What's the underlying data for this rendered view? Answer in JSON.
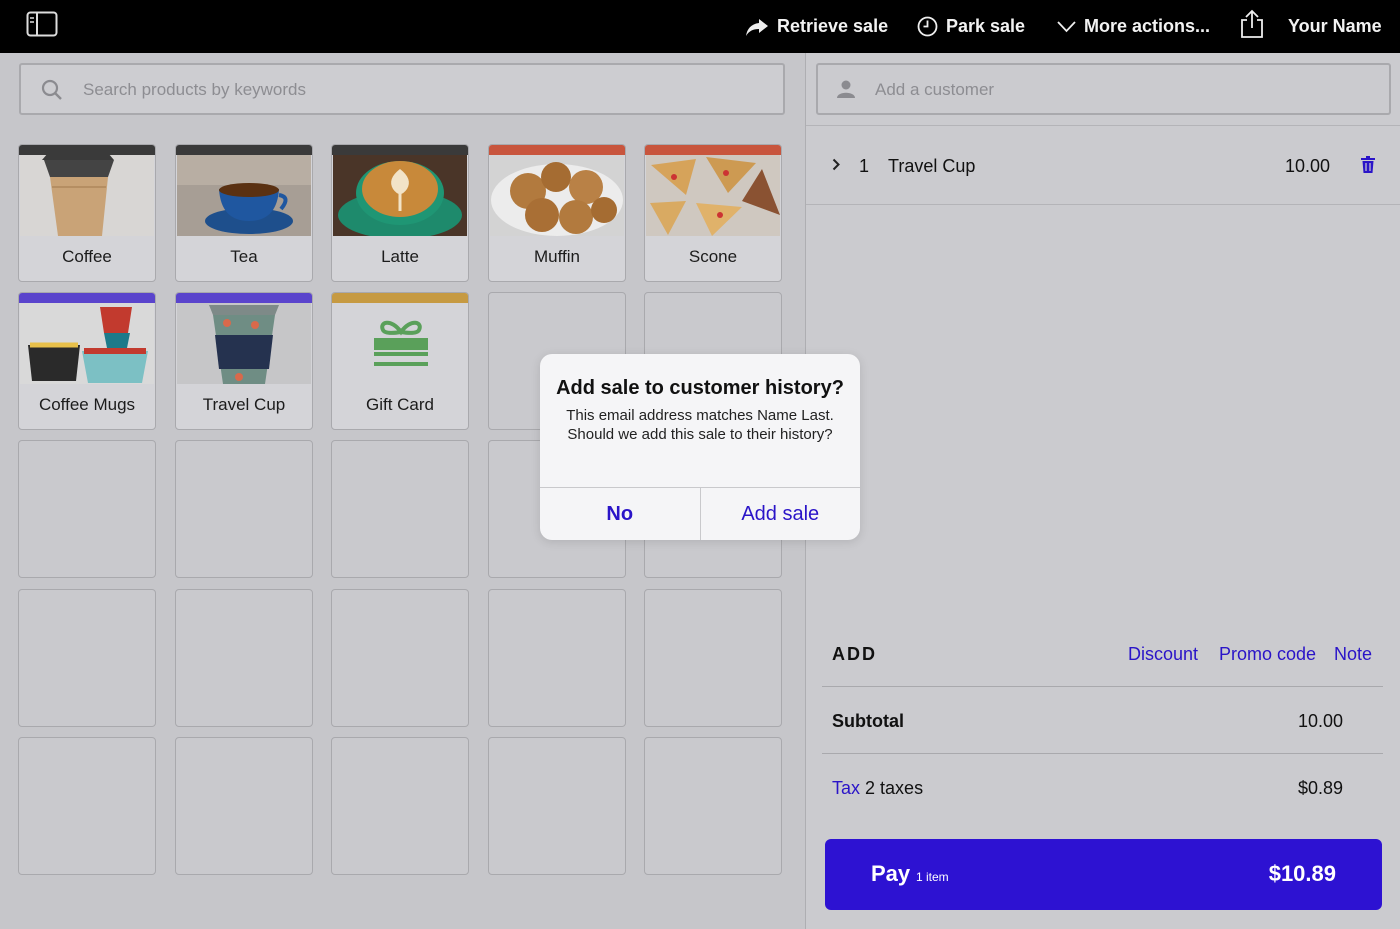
{
  "topbar": {
    "retrieve_sale": "Retrieve sale",
    "park_sale": "Park sale",
    "more_actions": "More actions...",
    "user_name": "Your Name"
  },
  "search": {
    "placeholder": "Search products by keywords"
  },
  "products": [
    {
      "label": "Coffee",
      "bar_color": "#3a3a3a"
    },
    {
      "label": "Tea",
      "bar_color": "#3a3a3a"
    },
    {
      "label": "Latte",
      "bar_color": "#3a3a3a"
    },
    {
      "label": "Muffin",
      "bar_color": "#c8553d"
    },
    {
      "label": "Scone",
      "bar_color": "#c8553d"
    },
    {
      "label": "Coffee Mugs",
      "bar_color": "#5a44cc"
    },
    {
      "label": "Travel Cup",
      "bar_color": "#5a44cc"
    },
    {
      "label": "Gift Card",
      "bar_color": "#c69a42"
    }
  ],
  "customer": {
    "placeholder": "Add a customer"
  },
  "cart": {
    "items": [
      {
        "qty": "1",
        "name": "Travel Cup",
        "price": "10.00"
      }
    ]
  },
  "add": {
    "label": "ADD",
    "discount": "Discount",
    "promo_code": "Promo code",
    "note": "Note"
  },
  "totals": {
    "subtotal_label": "Subtotal",
    "subtotal_value": "10.00",
    "tax_label": "Tax",
    "tax_detail": "2 taxes",
    "tax_value": "$0.89"
  },
  "pay": {
    "label": "Pay",
    "count": "1 item",
    "total": "$10.89"
  },
  "modal": {
    "title": "Add sale to customer history?",
    "message": "This email address matches Name Last. Should we add this sale to their history?",
    "no": "No",
    "add_sale": "Add sale"
  },
  "colors": {
    "accent": "#2d12d2",
    "link": "#2a14c8",
    "topbar": "#000000"
  }
}
